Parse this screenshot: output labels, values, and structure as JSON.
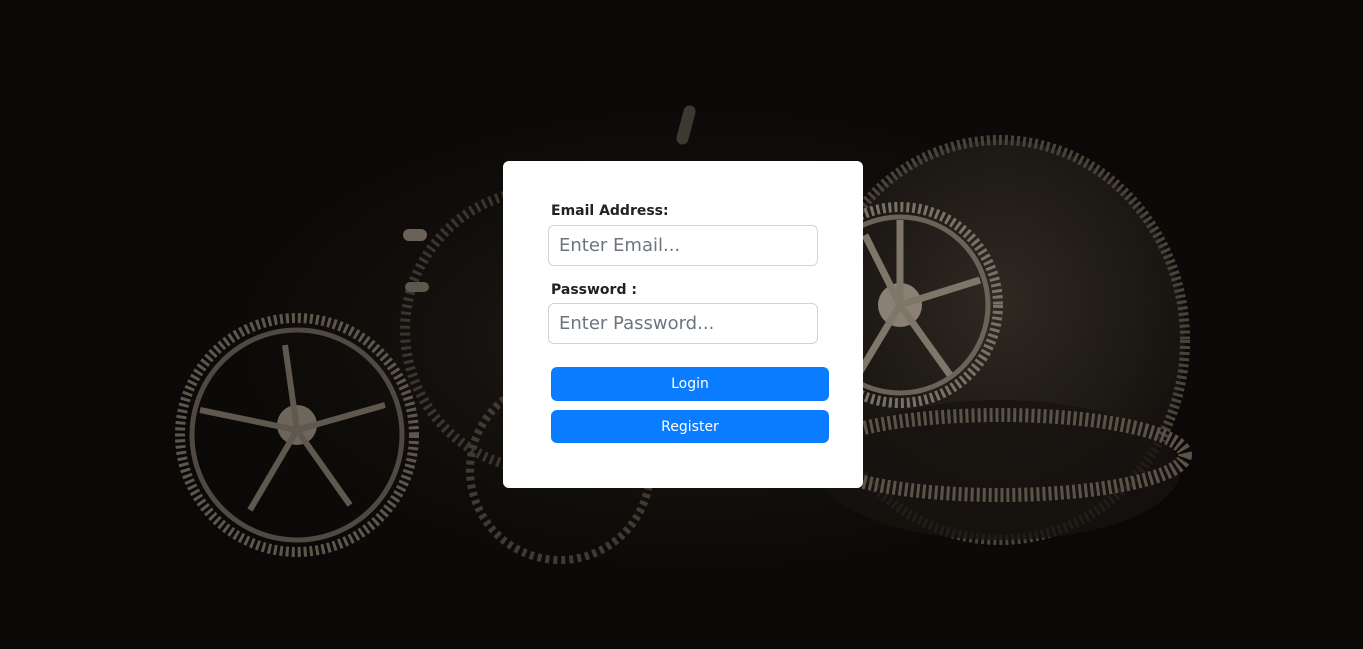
{
  "background": {
    "image": "gears-background",
    "color": "#0b0907"
  },
  "form": {
    "email_label": "Email Address:",
    "email_placeholder": "Enter Email...",
    "email_value": "",
    "password_label": "Password :",
    "password_placeholder": "Enter Password...",
    "password_value": "",
    "login_label": "Login",
    "register_label": "Register",
    "button_color": "#0a7cff"
  }
}
